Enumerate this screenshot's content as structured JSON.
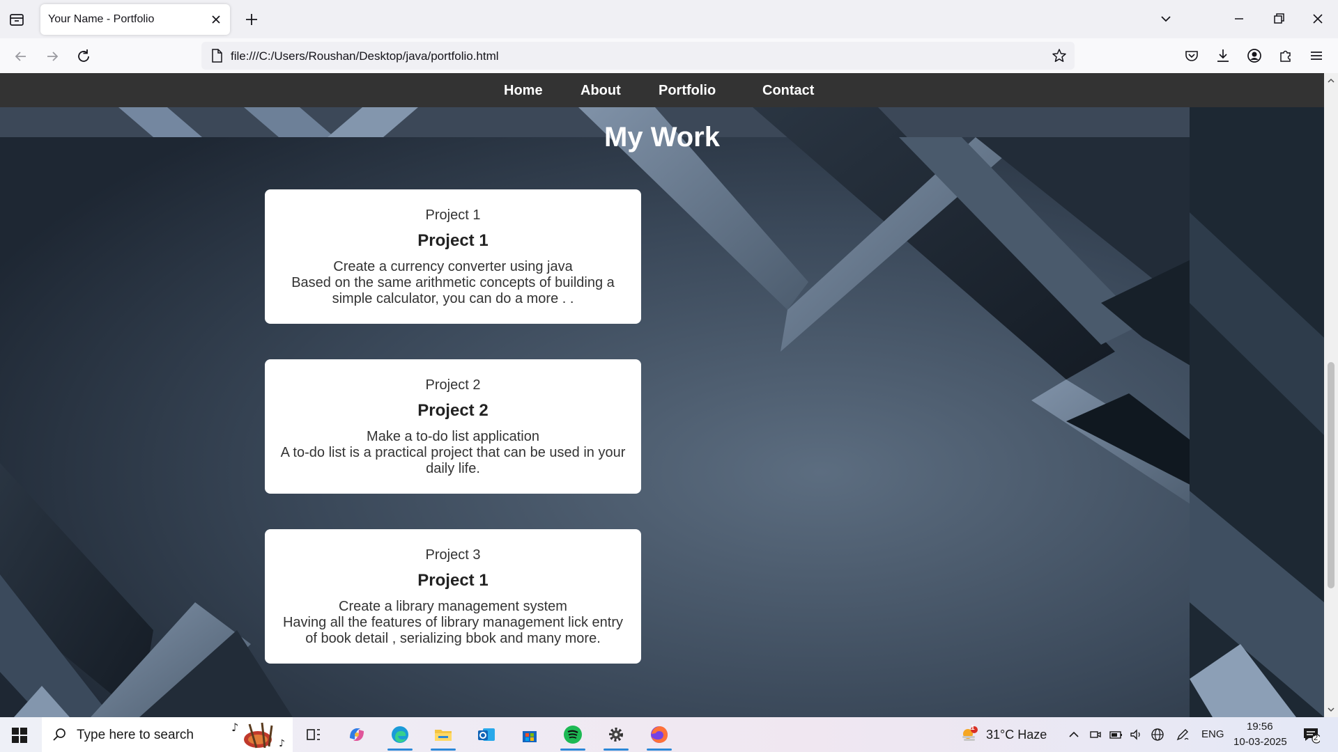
{
  "browser": {
    "tab_title": "Your Name - Portfolio",
    "url": "file:///C:/Users/Roushan/Desktop/java/portfolio.html"
  },
  "site": {
    "nav": [
      "Home",
      "About",
      "Portfolio",
      "Contact"
    ],
    "heading": "My Work",
    "projects": [
      {
        "kicker": "Project 1",
        "title": "Project 1",
        "desc_line1": "Create a currency converter using java",
        "desc_line2": "Based on the same arithmetic concepts of building a simple calculator, you can do a more . ."
      },
      {
        "kicker": "Project 2",
        "title": "Project 2",
        "desc_line1": "Make a to-do list application",
        "desc_line2": "A to-do list is a practical project that can be used in your daily life."
      },
      {
        "kicker": "Project 3",
        "title": "Project 1",
        "desc_line1": "Create a library management system",
        "desc_line2": "Having all the features of library management lick entry of book detail , serializing bbok and many more."
      }
    ]
  },
  "taskbar": {
    "search_placeholder": "Type here to search",
    "weather": "31°C  Haze",
    "weather_badge": "1",
    "language": "ENG",
    "time": "19:56",
    "date": "10-03-2025",
    "notification_count": "2"
  },
  "colors": {
    "site_nav_bg": "#333333",
    "card_bg": "#ffffff",
    "page_bg": "#2f3a47",
    "accent": "#2b88d8"
  }
}
